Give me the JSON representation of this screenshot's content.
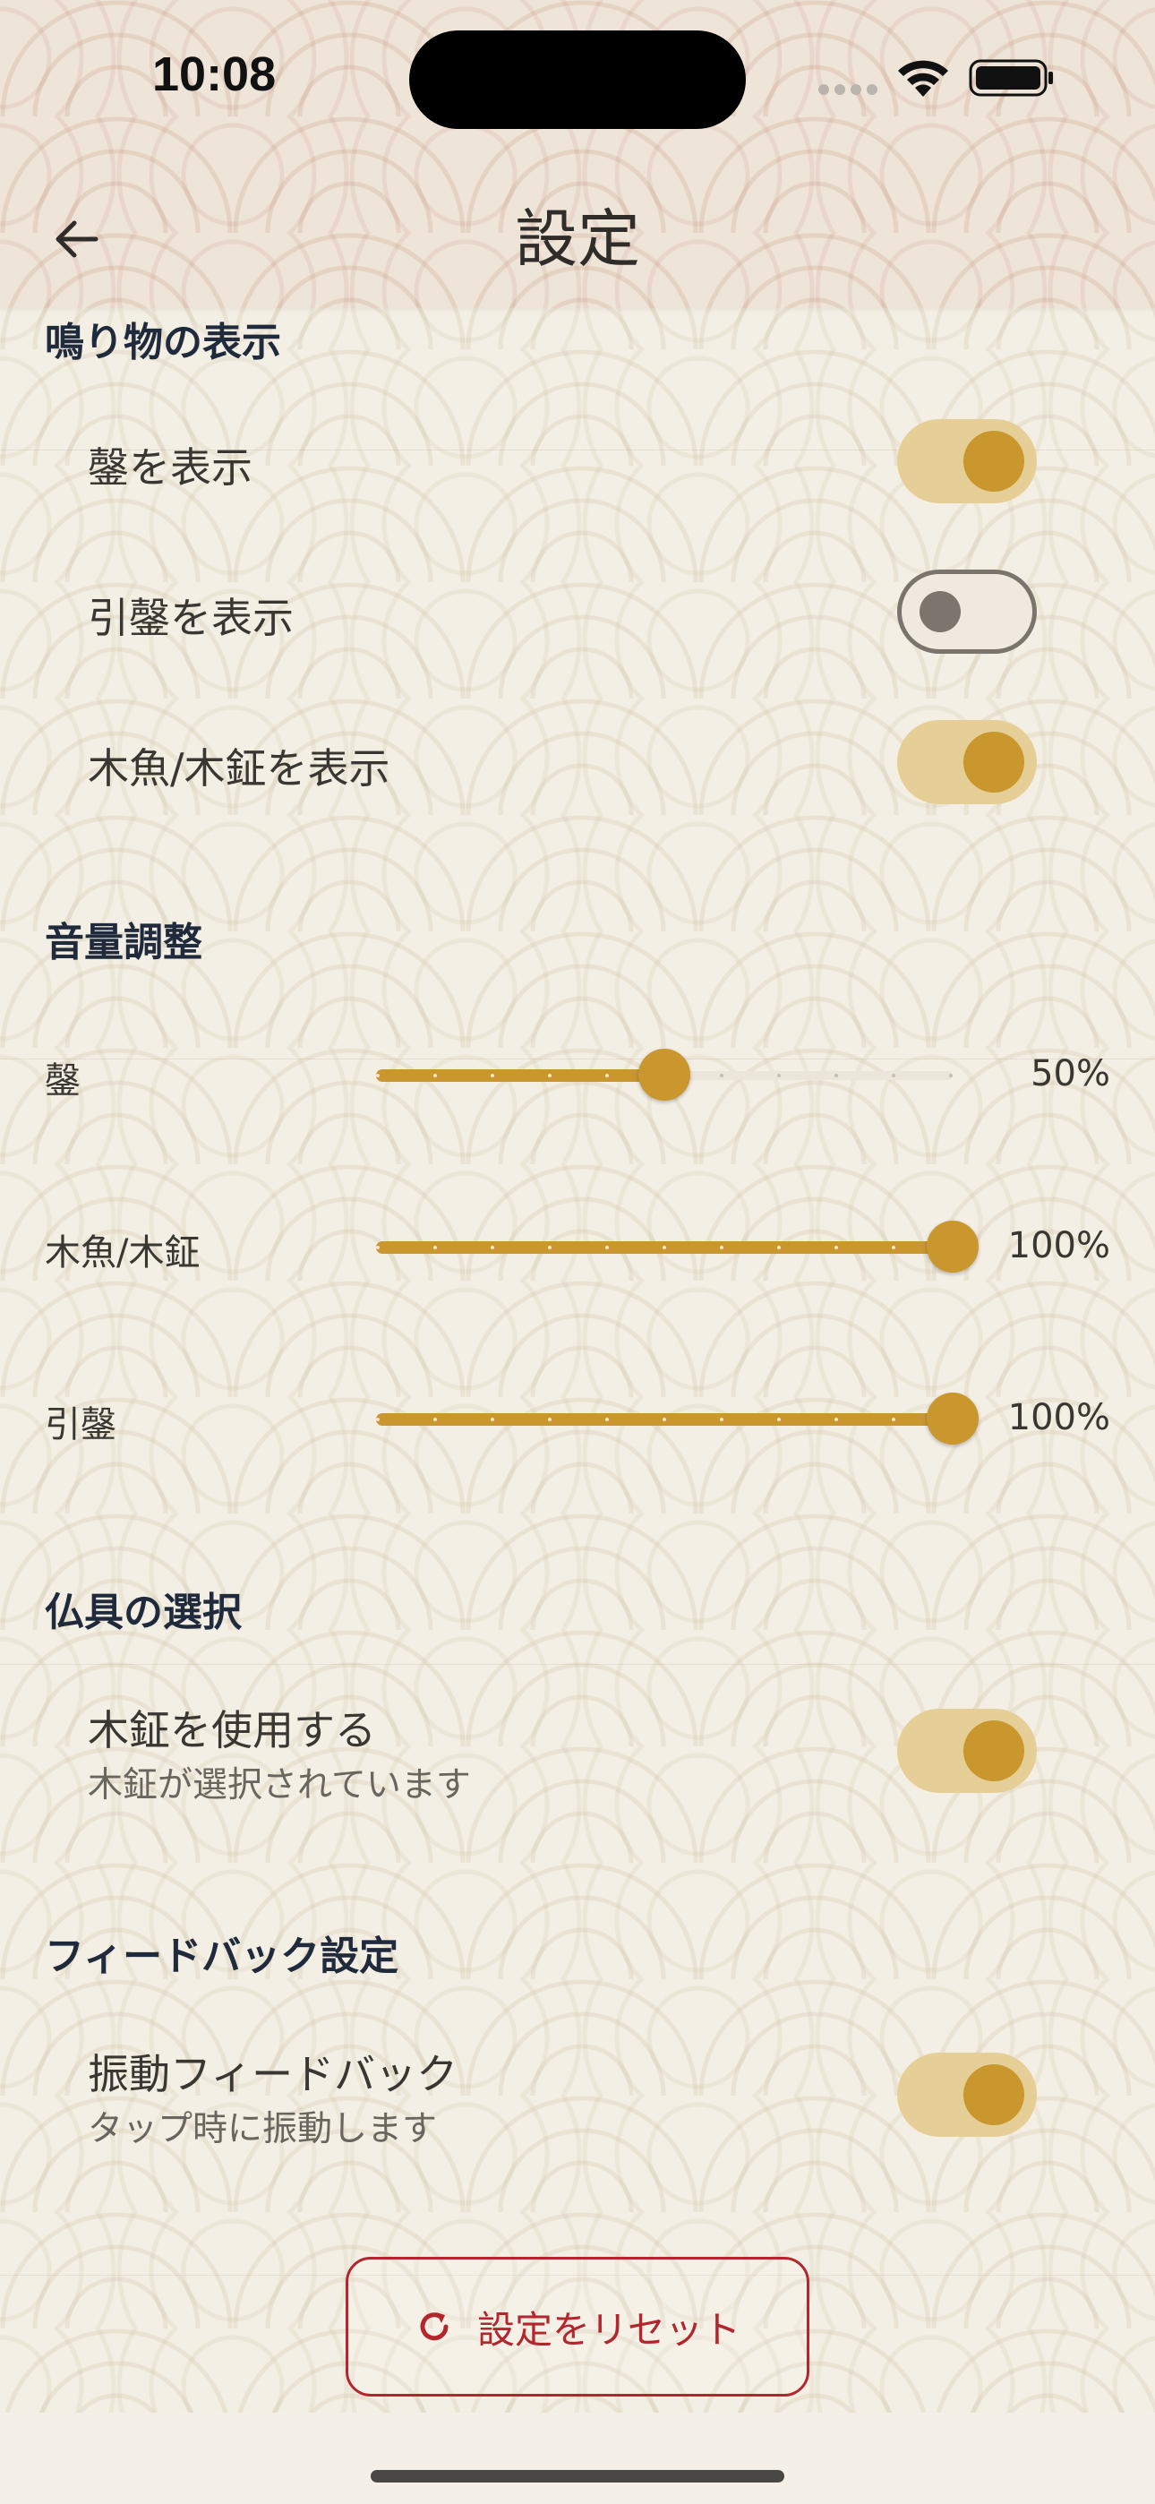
{
  "status_bar": {
    "time": "10:08"
  },
  "header": {
    "title": "設定",
    "back_icon": "arrow-left-icon"
  },
  "sections": {
    "display": {
      "title": "鳴り物の表示",
      "items": [
        {
          "label": "鏧を表示",
          "on": true
        },
        {
          "label": "引鏧を表示",
          "on": false
        },
        {
          "label": "木魚/木鉦を表示",
          "on": true
        }
      ]
    },
    "volume": {
      "title": "音量調整",
      "sliders": [
        {
          "label": "鏧",
          "value": 0.5,
          "value_text": "50%"
        },
        {
          "label": "木魚/木鉦",
          "value": 1.0,
          "value_text": "100%"
        },
        {
          "label": "引鏧",
          "value": 1.0,
          "value_text": "100%"
        }
      ]
    },
    "instrument": {
      "title": "仏具の選択",
      "item": {
        "label": "木鉦を使用する",
        "subtitle": "木鉦が選択されています",
        "on": true
      }
    },
    "feedback": {
      "title": "フィードバック設定",
      "item": {
        "label": "振動フィードバック",
        "subtitle": "タップ時に振動します",
        "on": true
      }
    }
  },
  "reset": {
    "label": "設定をリセット",
    "icon": "refresh-icon"
  },
  "colors": {
    "accent": "#c9972e",
    "accent_light": "#e6cf96",
    "danger": "#b3262e",
    "section_title": "#1f2a3c"
  }
}
